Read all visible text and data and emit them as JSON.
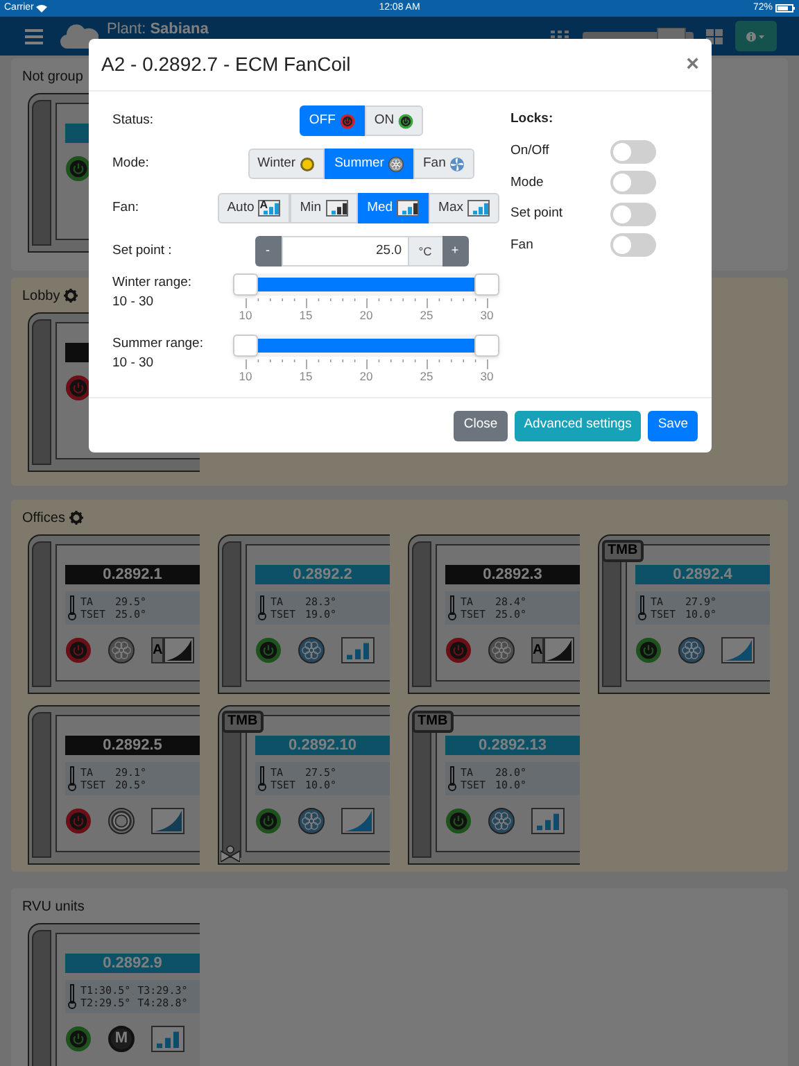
{
  "status_bar": {
    "carrier": "Carrier",
    "time": "12:08 AM",
    "battery": "72%"
  },
  "navbar": {
    "plant": "Plant: **Sabiana**"
  },
  "groups": [
    {
      "title": "Not group",
      "settings": false,
      "devices": [
        {
          "on": true
        }
      ]
    },
    {
      "title": "Lobby",
      "settings": true,
      "devices": [
        {
          "on": false
        }
      ]
    },
    {
      "title": "Offices",
      "settings": true,
      "devices": [
        {
          "name": "0.2892.1",
          "on": false,
          "readings": [
            [
              "TA",
              "29.5°"
            ],
            [
              "TSET",
              "25.0°"
            ]
          ],
          "mode": {
            "kind": "summer"
          },
          "fan": {
            "kind": "auto",
            "text": "A"
          }
        },
        {
          "name": "0.2892.2",
          "on": true,
          "readings": [
            [
              "TA",
              "28.3°"
            ],
            [
              "TSET",
              "19.0°"
            ]
          ],
          "mode": {
            "kind": "summer"
          },
          "fan": {
            "kind": "steps"
          }
        },
        {
          "name": "0.2892.3",
          "on": false,
          "readings": [
            [
              "TA",
              "28.4°"
            ],
            [
              "TSET",
              "25.0°"
            ]
          ],
          "mode": {
            "kind": "summer"
          },
          "fan": {
            "kind": "auto",
            "text": "A"
          }
        },
        {
          "name": "0.2892.4",
          "on": true,
          "badge": "TMB",
          "readings": [
            [
              "TA",
              "27.9°"
            ],
            [
              "TSET",
              "10.0°"
            ]
          ],
          "mode": {
            "kind": "summer"
          },
          "fan": {
            "kind": "ramp"
          }
        },
        {
          "name": "0.2892.5",
          "on": false,
          "readings": [
            [
              "TA",
              "29.1°"
            ],
            [
              "TSET",
              "20.5°"
            ]
          ],
          "mode": {
            "kind": "ring"
          },
          "fan": {
            "kind": "ramp"
          }
        },
        {
          "name": "0.2892.10",
          "on": true,
          "badge": "TMB",
          "valve": true,
          "readings": [
            [
              "TA",
              "27.5°"
            ],
            [
              "TSET",
              "10.0°"
            ]
          ],
          "mode": {
            "kind": "summer"
          },
          "fan": {
            "kind": "ramp"
          }
        },
        {
          "name": "0.2892.13",
          "on": true,
          "badge": "TMB",
          "readings": [
            [
              "TA",
              "28.0°"
            ],
            [
              "TSET",
              "10.0°"
            ]
          ],
          "mode": {
            "kind": "summer"
          },
          "fan": {
            "kind": "steps"
          }
        }
      ]
    },
    {
      "title": "RVU units",
      "settings": false,
      "devices": [
        {
          "name": "0.2892.9",
          "on": true,
          "readings": [
            [
              "T1:30.5°",
              "T3:29.3°"
            ],
            [
              "T2:29.5°",
              "T4:28.8°"
            ]
          ],
          "mode": {
            "kind": "manual",
            "text": "M"
          },
          "fan": {
            "kind": "steps"
          }
        }
      ]
    }
  ],
  "modal": {
    "title": "A2 - 0.2892.7 - ECM FanCoil",
    "close": "×",
    "status": {
      "label": "Status:",
      "options": [
        {
          "label": "OFF",
          "kind": "off",
          "selected": true
        },
        {
          "label": "ON",
          "kind": "on",
          "selected": false
        }
      ]
    },
    "mode": {
      "label": "Mode:",
      "options": [
        {
          "label": "Winter",
          "kind": "winter",
          "selected": false
        },
        {
          "label": "Summer",
          "kind": "summer",
          "selected": true
        },
        {
          "label": "Fan",
          "kind": "fan",
          "selected": false
        }
      ]
    },
    "fan": {
      "label": "Fan:",
      "options": [
        {
          "label": "Auto",
          "kind": "auto",
          "icon_text": "A",
          "selected": false
        },
        {
          "label": "Min",
          "kind": "min",
          "selected": false
        },
        {
          "label": "Med",
          "kind": "med",
          "selected": true
        },
        {
          "label": "Max",
          "kind": "max",
          "selected": false
        }
      ]
    },
    "setpoint": {
      "label": "Set point :",
      "minus": "-",
      "value": "25.0",
      "unit": "°C",
      "plus": "+"
    },
    "ranges": [
      {
        "label": "Winter range:",
        "range": "10 - 30",
        "level": 1,
        "ticks": [
          "10",
          "15",
          "20",
          "25",
          "30"
        ]
      },
      {
        "label": "Summer range:",
        "range": "10 - 30",
        "level": 1,
        "ticks": [
          "10",
          "15",
          "20",
          "25",
          "30"
        ]
      }
    ],
    "locks": {
      "title": "Locks:",
      "items": [
        {
          "label": "On/Off",
          "on": false
        },
        {
          "label": "Mode",
          "on": false
        },
        {
          "label": "Set point",
          "on": false
        },
        {
          "label": "Fan",
          "on": false
        }
      ]
    },
    "buttons": [
      {
        "label": "Close",
        "kind": "secondary"
      },
      {
        "label": "Advanced settings",
        "kind": "info"
      },
      {
        "label": "Save",
        "kind": "primary"
      }
    ]
  }
}
